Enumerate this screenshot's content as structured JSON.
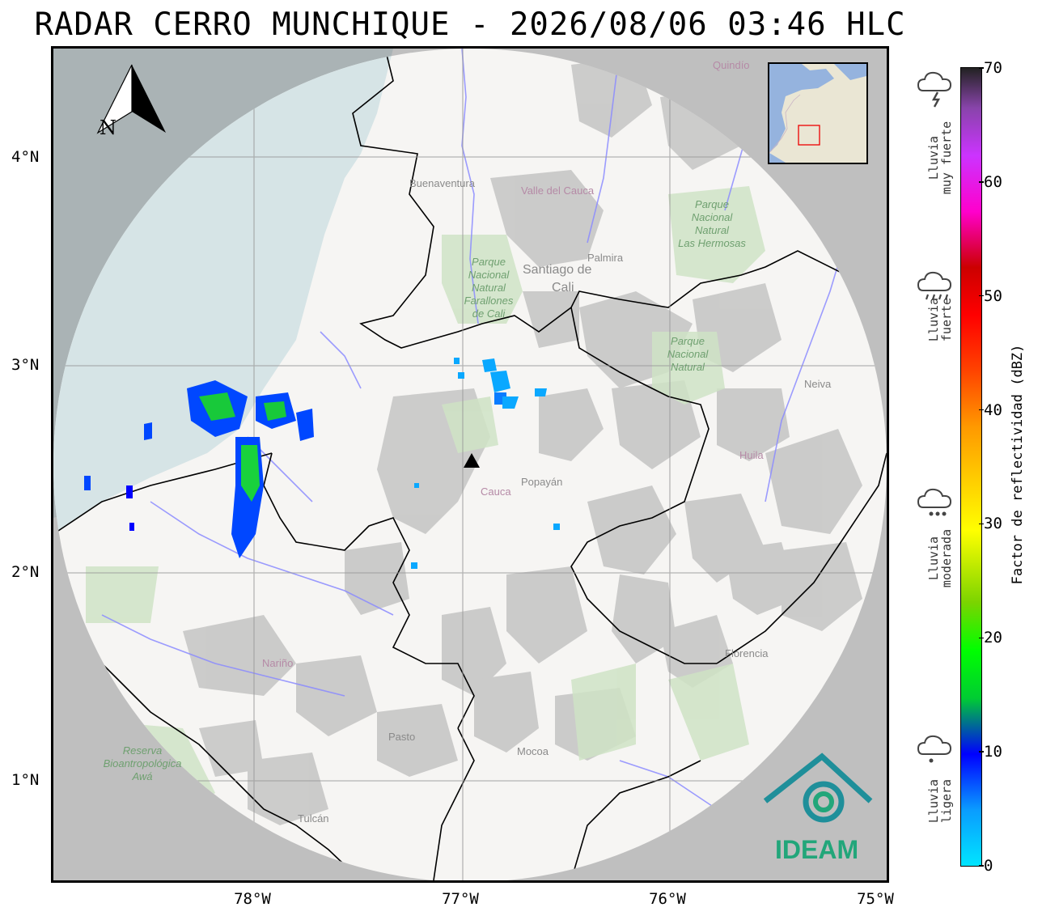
{
  "title": "RADAR CERRO MUNCHIQUE - 2026/08/06 03:46 HLC",
  "map": {
    "north_arrow_label": "N",
    "x_ticks": [
      "78°W",
      "77°W",
      "76°W",
      "75°W"
    ],
    "y_ticks": [
      "4°N",
      "3°N",
      "2°N",
      "1°N"
    ],
    "radar_site_marker": "triangle",
    "places": {
      "quindio": "Quindío",
      "buenaventura": "Buenaventura",
      "valle": "Valle del Cauca",
      "cali_1": "Santiago de",
      "cali_2": "Cali",
      "palmira": "Palmira",
      "farallones_1": "Parque",
      "farallones_2": "Nacional",
      "farallones_3": "Natural",
      "farallones_4": "Farallones",
      "farallones_5": "de Cali",
      "hermosas_1": "Parque",
      "hermosas_2": "Nacional",
      "hermosas_3": "Natural",
      "hermosas_4": "Las Hermosas",
      "nevado_1": "Parque",
      "nevado_2": "Nacional",
      "nevado_3": "Natural",
      "neiva": "Neiva",
      "huila": "Huila",
      "cauca": "Cauca",
      "popayan": "Popayán",
      "narino": "Nariño",
      "florencia": "Florencia",
      "pasto": "Pasto",
      "mocoa": "Mocoa",
      "tulcan": "Tulcán",
      "awa_1": "Reserva",
      "awa_2": "Bioantropológica",
      "awa_3": "Awá"
    },
    "logo_text": "IDEAM",
    "colors": {
      "ocean": "#d6e4e6",
      "land": "#f6f5f3",
      "out_of_range": "#bfbfbf",
      "park_green": "#cfe3c5",
      "river": "#8b8bff",
      "boundary": "#000000",
      "logo_teal": "#1f8f9a",
      "logo_green": "#22a67a"
    }
  },
  "colorbar": {
    "label": "Factor de reflectividad (dBZ)",
    "ticks": [
      "0",
      "10",
      "20",
      "30",
      "40",
      "50",
      "60",
      "70"
    ],
    "min": 0,
    "max": 70
  },
  "rain_categories": [
    {
      "lines": [
        "Lluvia",
        "muy fuerte"
      ],
      "icon": "thunderstorm-icon"
    },
    {
      "lines": [
        "Lluvia",
        "fuerte"
      ],
      "icon": "heavy-rain-icon"
    },
    {
      "lines": [
        "Lluvia",
        "moderada"
      ],
      "icon": "moderate-rain-icon"
    },
    {
      "lines": [
        "Lluvia",
        "ligera"
      ],
      "icon": "light-rain-icon"
    }
  ]
}
